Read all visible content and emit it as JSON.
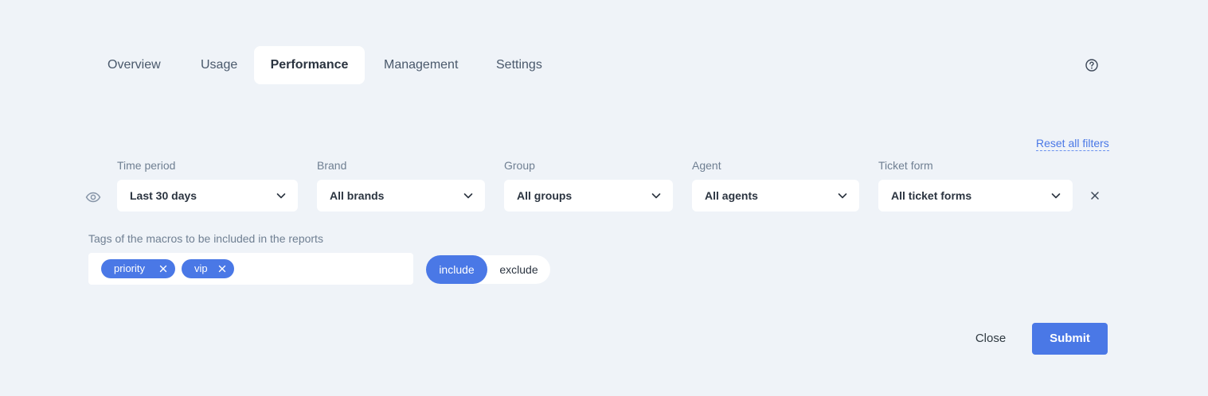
{
  "tabs": [
    {
      "label": "Overview",
      "active": false
    },
    {
      "label": "Usage",
      "active": false
    },
    {
      "label": "Performance",
      "active": true
    },
    {
      "label": "Management",
      "active": false
    },
    {
      "label": "Settings",
      "active": false
    }
  ],
  "header": {
    "help_icon": "question-circle-icon"
  },
  "filters": {
    "reset_label": "Reset all filters",
    "visibility_icon": "eye-icon",
    "clear_icon": "close-icon",
    "items": [
      {
        "label": "Time period",
        "value": "Last 30 days"
      },
      {
        "label": "Brand",
        "value": "All brands"
      },
      {
        "label": "Group",
        "value": "All groups"
      },
      {
        "label": "Agent",
        "value": "All agents"
      },
      {
        "label": "Ticket form",
        "value": "All ticket forms"
      }
    ]
  },
  "tags": {
    "label": "Tags of the macros to be included in the reports",
    "chips": [
      "priority",
      "vip"
    ],
    "mode_options": [
      "include",
      "exclude"
    ],
    "mode_selected": "include"
  },
  "actions": {
    "close_label": "Close",
    "submit_label": "Submit"
  },
  "colors": {
    "background": "#eff3f8",
    "accent": "#4a78e6",
    "text": "#2b3440",
    "muted": "#6f7f92"
  }
}
